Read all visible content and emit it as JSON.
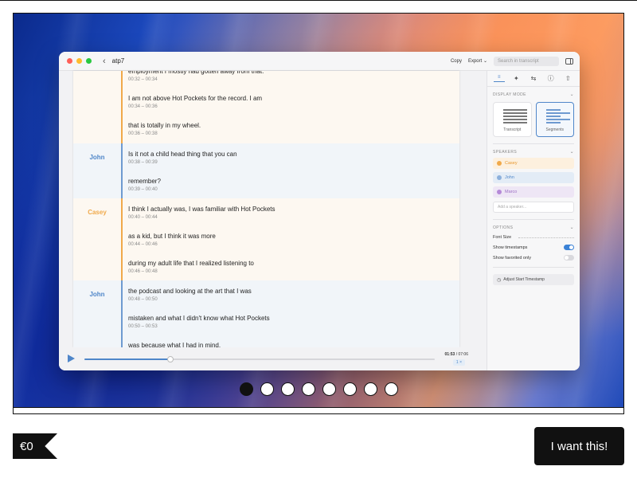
{
  "app": {
    "window_title": "atp7",
    "back_glyph": "‹",
    "toolbar": {
      "copy_label": "Copy",
      "export_label": "Export",
      "export_chevron": "⌄",
      "search_placeholder": "Search in transcript"
    }
  },
  "transcript": {
    "segments": [
      {
        "speaker": "Casey",
        "speaker_label": "",
        "lines": [
          {
            "text": "employment I mostly had gotten away from that.",
            "ts": "00:32 – 00:34"
          },
          {
            "text": "I am not above Hot Pockets for the record. I am",
            "ts": "00:34 – 00:36"
          },
          {
            "text": "that is totally in my wheel.",
            "ts": "00:36 – 00:38"
          }
        ]
      },
      {
        "speaker": "John",
        "speaker_label": "John",
        "lines": [
          {
            "text": "Is it not a child head thing that you can",
            "ts": "00:38 – 00:39"
          },
          {
            "text": "remember?",
            "ts": "00:39 – 00:40"
          }
        ]
      },
      {
        "speaker": "Casey",
        "speaker_label": "Casey",
        "lines": [
          {
            "text": "I think I actually was, I was familiar with Hot Pockets",
            "ts": "00:40 – 00:44"
          },
          {
            "text": "as a kid, but I think it was more",
            "ts": "00:44 – 00:46"
          },
          {
            "text": "during my adult life that I realized listening to",
            "ts": "00:46 – 00:48"
          }
        ]
      },
      {
        "speaker": "John",
        "speaker_label": "John",
        "lines": [
          {
            "text": "the podcast and looking at the art that I was",
            "ts": "00:48 – 00:50"
          },
          {
            "text": "mistaken and what I didn't know what Hot Pockets",
            "ts": "00:50 – 00:53"
          },
          {
            "text": "was because what I had in mind.",
            "ts": ""
          }
        ]
      }
    ]
  },
  "player": {
    "current_time": "01:53",
    "total_time": "07:06",
    "time_separator": " / ",
    "speed": "1 ×",
    "progress": 0.245
  },
  "panel": {
    "tabs": [
      {
        "name": "transcript-tab",
        "glyph": "≡",
        "active": true
      },
      {
        "name": "sparkle-tab",
        "glyph": "✦",
        "active": false
      },
      {
        "name": "translate-tab",
        "glyph": "⇆",
        "active": false
      },
      {
        "name": "info-tab",
        "glyph": "ⓘ",
        "active": false
      },
      {
        "name": "share-tab",
        "glyph": "⇧",
        "active": false
      }
    ],
    "display_mode": {
      "heading": "DISPLAY MODE",
      "options": [
        {
          "label": "Transcript",
          "selected": false
        },
        {
          "label": "Segments",
          "selected": true
        }
      ]
    },
    "speakers": {
      "heading": "SPEAKERS",
      "items": [
        {
          "name": "Casey",
          "color": "#f0a94a"
        },
        {
          "name": "John",
          "color": "#8cb0dc"
        },
        {
          "name": "Marco",
          "color": "#b58ad8"
        }
      ],
      "add_placeholder": "Add a speaker..."
    },
    "options": {
      "heading": "OPTIONS",
      "font_size_label": "Font Size",
      "show_timestamps_label": "Show timestamps",
      "show_timestamps": true,
      "show_favorited_label": "Show favorited only",
      "show_favorited": false,
      "adjust_button": "Adjust Start Timestamp"
    },
    "chevron": "⌄"
  },
  "carousel": {
    "count": 8,
    "active_index": 0
  },
  "product": {
    "price": "€0",
    "buy_label": "I want this!"
  },
  "colors": {
    "accent": "#4f86c9",
    "casey": "#f0a94a",
    "john": "#6e9ad0"
  }
}
